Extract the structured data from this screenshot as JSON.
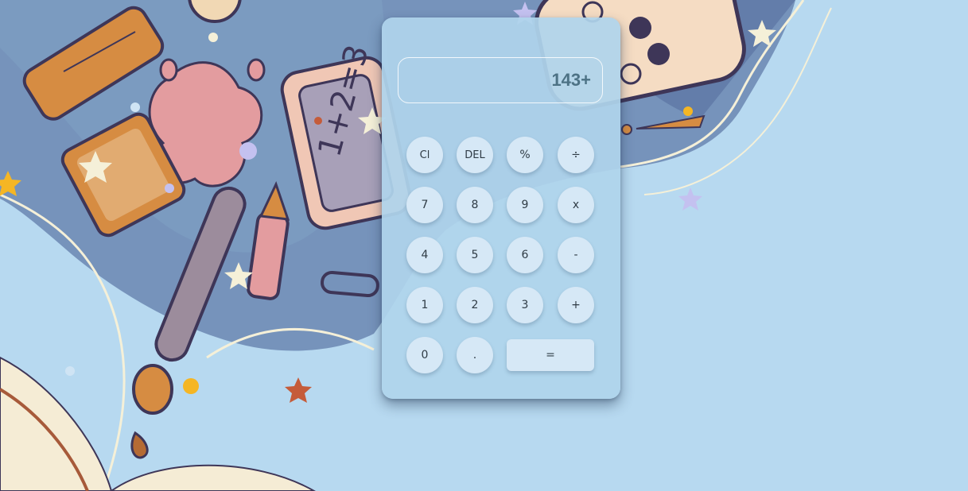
{
  "calculator": {
    "display": "143+",
    "keys": {
      "clear": "Cl",
      "delete": "DEL",
      "percent": "%",
      "divide": "÷",
      "seven": "7",
      "eight": "8",
      "nine": "9",
      "multiply": "x",
      "four": "4",
      "five": "5",
      "six": "6",
      "minus": "-",
      "one": "1",
      "two": "2",
      "three": "3",
      "plus": "+",
      "zero": "0",
      "decimal": ".",
      "equals": "="
    }
  },
  "background": {
    "illustration": "school supplies doodle (ruler, glue tube, paint splat, calculator, pencil, paintbrush, open book, stars)",
    "colors": {
      "sky": "#b7d9f0",
      "watercolor": "#5f7aa6",
      "ruler": "#d68c42",
      "outline": "#3e3658"
    }
  }
}
